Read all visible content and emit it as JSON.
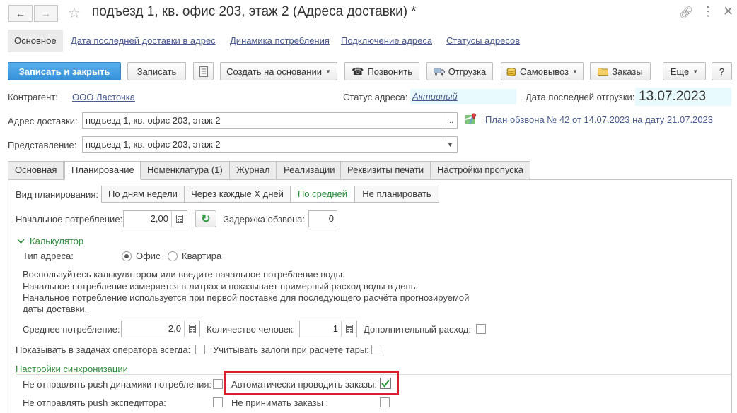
{
  "window": {
    "title": "подъезд 1, кв. офис 203, этаж 2 (Адреса доставки) *"
  },
  "sections": [
    {
      "label": "Основное"
    },
    {
      "label": "Дата последней доставки в адрес"
    },
    {
      "label": "Динамика потребления"
    },
    {
      "label": "Подключение адреса"
    },
    {
      "label": "Статусы адресов"
    }
  ],
  "toolbar": {
    "save_close": "Записать и закрыть",
    "save": "Записать",
    "create_based": "Создать на основании",
    "call": "Позвонить",
    "shipment": "Отгрузка",
    "pickup": "Самовывоз",
    "orders": "Заказы",
    "more": "Еще",
    "help": "?"
  },
  "header": {
    "contractor_label": "Контрагент:",
    "contractor_value": "ООО Ласточка",
    "status_label": "Статус адреса:",
    "status_value": "Активный",
    "last_ship_label": "Дата последней отгрузки:",
    "last_ship_value": "13.07.2023",
    "address_label": "Адрес доставки:",
    "address_value": "подъезд 1, кв. офис 203, этаж 2",
    "plan_link": "План обзвона № 42 от 14.07.2023 на дату 21.07.2023",
    "repr_label": "Представление:",
    "repr_value": "подъезд 1, кв. офис 203, этаж 2"
  },
  "tabs": [
    {
      "label": "Основная"
    },
    {
      "label": "Планирование"
    },
    {
      "label": "Номенклатура (1)"
    },
    {
      "label": "Журнал"
    },
    {
      "label": "Реализации"
    },
    {
      "label": "Реквизиты печати"
    },
    {
      "label": "Настройки пропуска"
    }
  ],
  "planning": {
    "mode_label": "Вид планирования:",
    "modes": [
      {
        "label": "По дням недели"
      },
      {
        "label": "Через каждые X дней"
      },
      {
        "label": "По средней"
      },
      {
        "label": "Не планировать"
      }
    ],
    "initial_label": "Начальное потребление:",
    "initial_value": "2,00",
    "delay_label": "Задержка обзвона:",
    "delay_value": "0",
    "calc_group": "Калькулятор",
    "addr_type_label": "Тип адреса:",
    "addr_type_office": "Офис",
    "addr_type_flat": "Квартира",
    "hint_1": "Воспользуйтесь калькулятором или введите начальное потребление воды.",
    "hint_2": "Начальное потребление измеряется в литрах и показывает примерный расход воды в день.",
    "hint_3": "Начальное потребление используется при первой поставке для последующего расчёта прогнозируемой",
    "hint_4": "даты доставки.",
    "avg_label": "Среднее потребление:",
    "avg_value": "2,0",
    "people_label": "Количество человек:",
    "people_value": "1",
    "extra_label": "Дополнительный расход:",
    "show_tasks_label": "Показывать в задачах оператора всегда:",
    "deposit_label": "Учитывать залоги при расчете тары:",
    "sync_link": "Настройки синхронизации",
    "no_push_dyn_label": "Не отправлять push динамики потребления:",
    "auto_post_label": "Автоматически проводить заказы:",
    "no_push_exp_label": "Не отправлять push экспедитора:",
    "no_accept_label": "Не принимать заказы :"
  }
}
